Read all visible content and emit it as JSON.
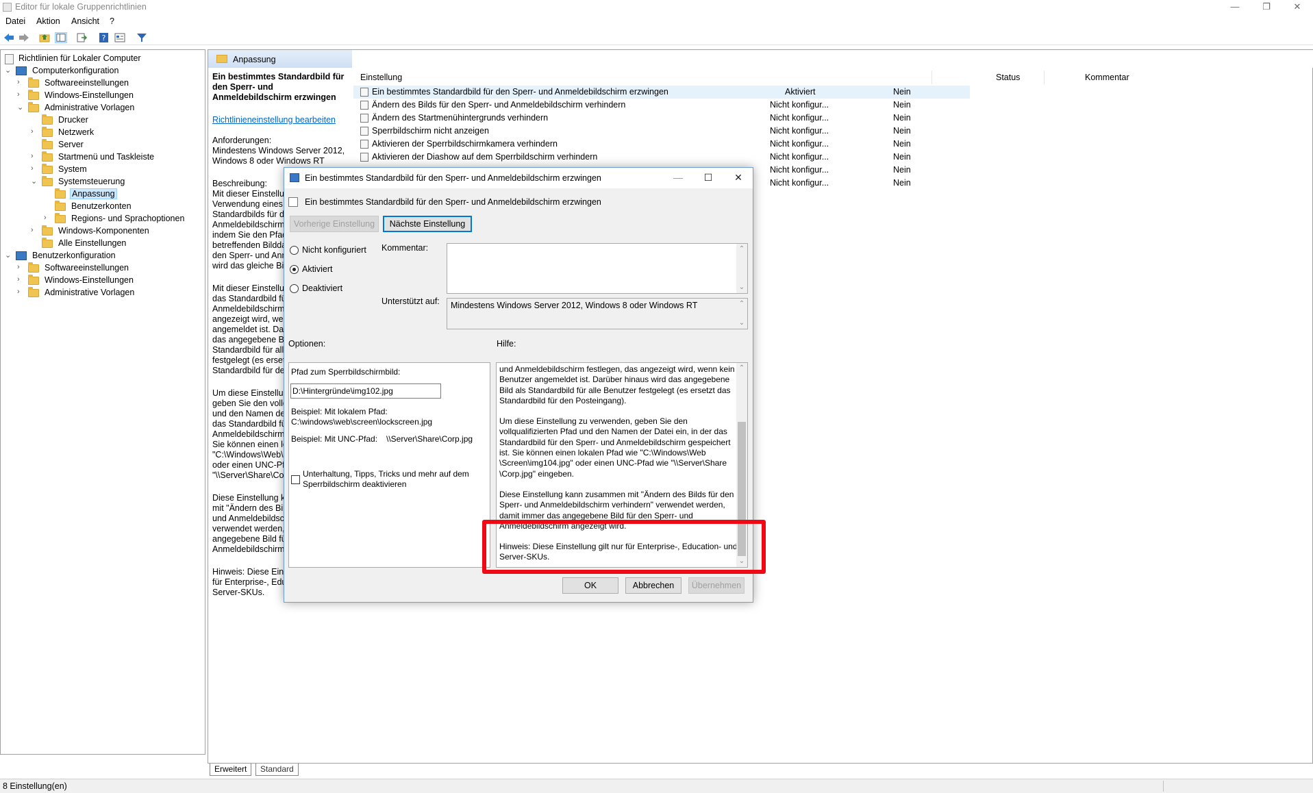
{
  "window": {
    "title": "Editor für lokale Gruppenrichtlinien",
    "min": "—",
    "max": "❐",
    "close": "✕"
  },
  "menu": [
    "Datei",
    "Aktion",
    "Ansicht",
    "?"
  ],
  "tree": {
    "root": "Richtlinien für Lokaler Computer",
    "items": [
      "Computerkonfiguration",
      "Softwareeinstellungen",
      "Windows-Einstellungen",
      "Administrative Vorlagen",
      "Drucker",
      "Netzwerk",
      "Server",
      "Startmenü und Taskleiste",
      "System",
      "Systemsteuerung",
      "Anpassung",
      "Benutzerkonten",
      "Regions- und Sprachoptionen",
      "Windows-Komponenten",
      "Alle Einstellungen",
      "Benutzerkonfiguration",
      "Softwareeinstellungen",
      "Windows-Einstellungen",
      "Administrative Vorlagen"
    ]
  },
  "breadcrumb": "Anpassung",
  "extended": {
    "title": "Ein bestimmtes Standardbild für den Sperr- und Anmeldebildschirm erzwingen",
    "edit_link": "Richtlinieneinstellung bearbeiten",
    "requirements_label": "Anforderungen:",
    "requirements_text": "Mindestens Windows Server 2012, Windows 8 oder Windows RT",
    "desc_label": "Beschreibung:",
    "desc1": "Mit dieser Einstellung können Sie die Verwendung eines bestimmten Standardbilds für den Sperr- und Anmeldebildschirm erzwingen, indem Sie den Pfad zu der betreffenden Bilddatei angeben. Für den Sperr- und Anmeldebildschirm wird das gleiche Bild verwendet.",
    "desc2": "Mit dieser Einstellung können Sie das Standardbild für den Sperr- und Anmeldebildschirm festlegen, das angezeigt wird, wenn kein Benutzer angemeldet ist. Darüber hinaus wird das angegebene Bild als Standardbild für alle Benutzer festgelegt (es ersetzt das Standardbild für den Posteingang).",
    "desc3": "Um diese Einstellung zu verwenden, geben Sie den vollqualifizierten Pfad und den Namen der Datei ein, in der das Standardbild für den Sperr- und Anmeldebildschirm gespeichert ist. Sie können einen lokalen Pfad wie \"C:\\Windows\\Web\\Screen\\img104.jpg\" oder einen UNC-Pfad wie \"\\\\Server\\Share\\Corp.jpg\" eingeben.",
    "desc4": "Diese Einstellung kann zusammen mit \"Ändern des Bilds für den Sperr- und Anmeldebildschirm verhindern\" verwendet werden, damit immer das angegebene Bild für den Sperr- und Anmeldebildschirm angezeigt wird.",
    "desc5": "Hinweis: Diese Einstellung gilt nur für Enterprise-, Education- und Server-SKUs."
  },
  "list": {
    "headers": {
      "setting": "Einstellung",
      "status": "Status",
      "comment": "Kommentar"
    },
    "rows": [
      {
        "name": "Ein bestimmtes Standardbild für den Sperr- und Anmeldebildschirm erzwingen",
        "status": "Aktiviert",
        "comment": "Nein"
      },
      {
        "name": "Ändern des Bilds für den Sperr- und Anmeldebildschirm verhindern",
        "status": "Nicht konfigur...",
        "comment": "Nein"
      },
      {
        "name": "Ändern des Startmenühintergrunds verhindern",
        "status": "Nicht konfigur...",
        "comment": "Nein"
      },
      {
        "name": "Sperrbildschirm nicht anzeigen",
        "status": "Nicht konfigur...",
        "comment": "Nein"
      },
      {
        "name": "Aktivieren der Sperrbildschirmkamera verhindern",
        "status": "Nicht konfigur...",
        "comment": "Nein"
      },
      {
        "name": "Aktivieren der Diashow auf dem Sperrbildschirm verhindern",
        "status": "Nicht konfigur...",
        "comment": "Nein"
      },
      {
        "name": "",
        "status": "Nicht konfigur...",
        "comment": "Nein"
      },
      {
        "name": "",
        "status": "Nicht konfigur...",
        "comment": "Nein"
      }
    ]
  },
  "tabs": [
    "Erweitert",
    "Standard"
  ],
  "statusbar": "8 Einstellung(en)",
  "dialog": {
    "title": "Ein bestimmtes Standardbild für den Sperr- und Anmeldebildschirm erzwingen",
    "heading": "Ein bestimmtes Standardbild für den Sperr- und Anmeldebildschirm erzwingen",
    "prev": "Vorherige Einstellung",
    "next": "Nächste Einstellung",
    "radio_not_configured": "Nicht konfiguriert",
    "radio_enabled": "Aktiviert",
    "radio_disabled": "Deaktiviert",
    "comment_label": "Kommentar:",
    "supported_label": "Unterstützt auf:",
    "supported_text": "Mindestens Windows Server 2012, Windows 8 oder Windows RT",
    "options_label": "Optionen:",
    "help_label": "Hilfe:",
    "path_label": "Pfad zum Sperrbildschirmbild:",
    "path_value": "D:\\Hintergründe\\img102.jpg",
    "example_local": "Beispiel: Mit lokalem Pfad:",
    "example_local_path": "C:\\windows\\web\\screen\\lockscreen.jpg",
    "example_unc": "Beispiel: Mit UNC-Pfad:",
    "example_unc_path": "\\\\Server\\Share\\Corp.jpg",
    "checkbox_label": "Unterhaltung, Tipps, Tricks und mehr auf dem Sperrbildschirm deaktivieren",
    "help_p1": "und Anmeldebildschirm festlegen, das angezeigt wird, wenn kein Benutzer angemeldet ist. Darüber hinaus wird das angegebene Bild als Standardbild für alle Benutzer festgelegt (es ersetzt das Standardbild für den Posteingang).",
    "help_p2": "Um diese Einstellung zu verwenden, geben Sie den vollqualifizierten Pfad und den Namen der Datei ein, in der das Standardbild für den Sperr- und Anmeldebildschirm gespeichert ist. Sie können einen lokalen Pfad wie \"C:\\Windows\\Web \\Screen\\img104.jpg\" oder einen UNC-Pfad wie \"\\\\Server\\Share \\Corp.jpg\" eingeben.",
    "help_p3": "Diese Einstellung kann zusammen mit \"Ändern des Bilds für den Sperr- und Anmeldebildschirm verhindern\" verwendet werden, damit immer das angegebene Bild für den Sperr- und Anmeldebildschirm angezeigt wird.",
    "help_p4": "Hinweis: Diese Einstellung gilt nur für Enterprise-, Education- und Server-SKUs.",
    "ok": "OK",
    "cancel": "Abbrechen",
    "apply": "Übernehmen"
  },
  "colors": {
    "highlight": "#ee0b15",
    "accent": "#0078d7"
  }
}
